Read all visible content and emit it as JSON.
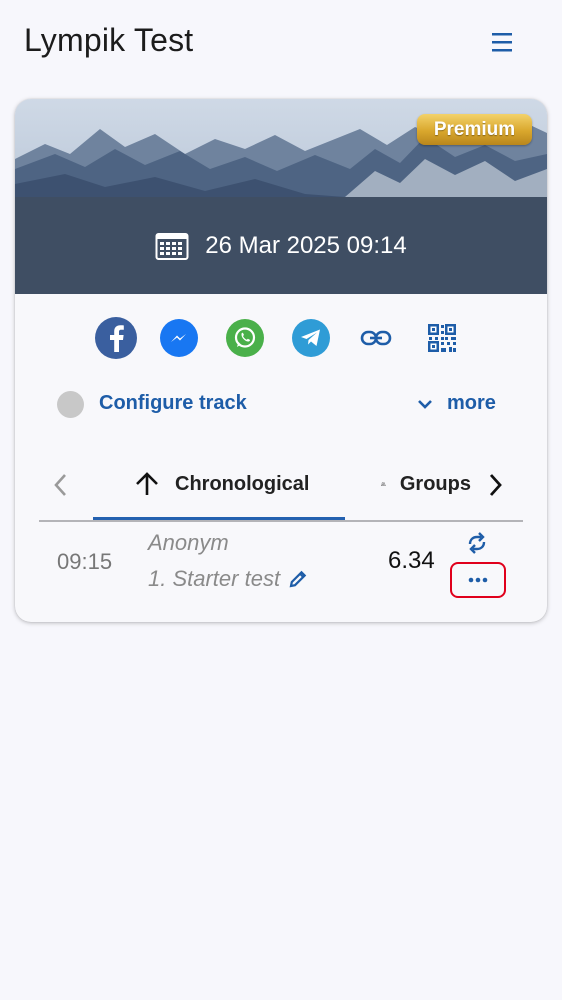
{
  "header": {
    "title": "Lympik Test",
    "menu_icon": "hamburger-menu-icon"
  },
  "event": {
    "badge": "Premium",
    "datetime": "26 Mar 2025 09:14",
    "calendar_icon": "calendar-icon",
    "colors": {
      "brand_blue": "#1e5da8",
      "badge_gold": "#d9a72d"
    }
  },
  "share": [
    {
      "name": "facebook-icon"
    },
    {
      "name": "messenger-icon"
    },
    {
      "name": "whatsapp-icon"
    },
    {
      "name": "telegram-icon"
    },
    {
      "name": "link-icon"
    },
    {
      "name": "qr-code-icon"
    }
  ],
  "config": {
    "label": "Configure track",
    "more_label": "more"
  },
  "tabs": {
    "items": [
      {
        "label": "Chronological",
        "icon": "arrow-up-icon",
        "active": true
      },
      {
        "label": "Groups",
        "icon": "group-icon",
        "active": false
      }
    ]
  },
  "results": [
    {
      "time": "09:15",
      "name": "Anonym",
      "track": "1. Starter test",
      "value": "6.34"
    }
  ]
}
